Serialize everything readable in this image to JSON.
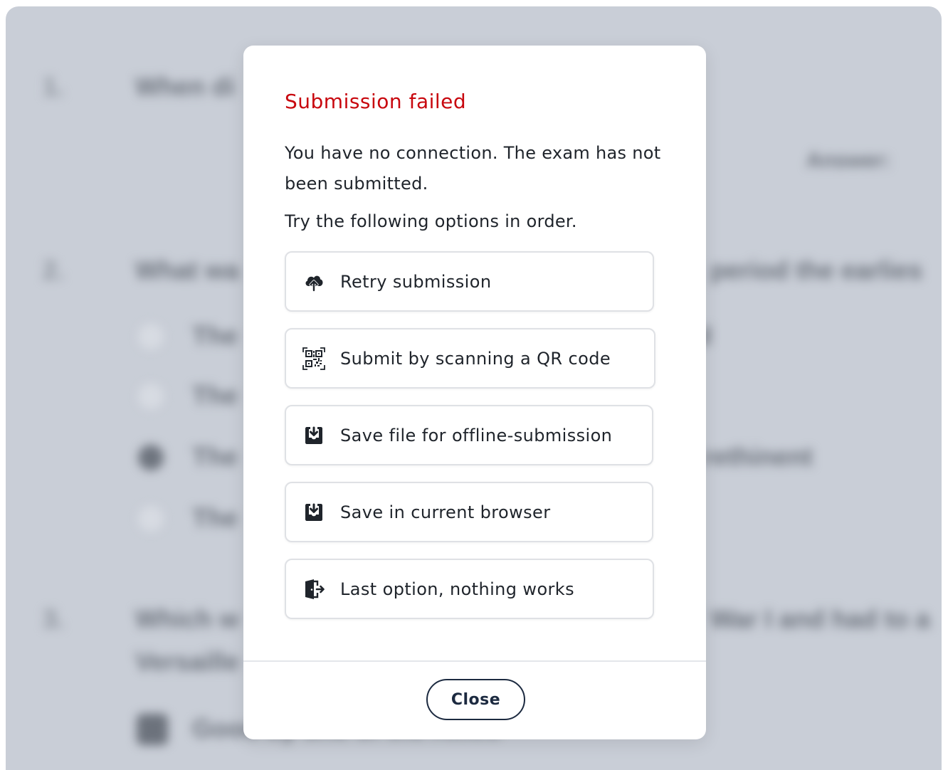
{
  "background": {
    "questions": [
      {
        "number": "1.",
        "text": "When di"
      },
      {
        "number": "2.",
        "text": "What wa"
      },
      {
        "number": "3.",
        "text": "Which w"
      }
    ],
    "right_fragments": [
      "Answer:",
      "period the earlies",
      "d"
    ],
    "q3_right": "War I and had to a",
    "q3_line2": "Versaille",
    "option_fragments": [
      "The",
      "The",
      "The",
      "The"
    ],
    "selected_fragment": "rethinent",
    "last_option": "Good by one of the Allies"
  },
  "modal": {
    "title": "Submission failed",
    "message": "You have no connection. The exam has not been submitted.",
    "hint": "Try the following options in order.",
    "options": [
      {
        "label": "Retry submission",
        "icon": "cloud-upload-icon"
      },
      {
        "label": "Submit by scanning a QR code",
        "icon": "qr-code-icon"
      },
      {
        "label": "Save file for offline-submission",
        "icon": "download-box-icon"
      },
      {
        "label": "Save in current browser",
        "icon": "download-box-icon"
      },
      {
        "label": "Last option, nothing works",
        "icon": "exit-door-icon"
      }
    ],
    "close_label": "Close"
  },
  "colors": {
    "title": "#c8070e",
    "close_border": "#1c2a40",
    "backdrop": "#c9ced7"
  }
}
